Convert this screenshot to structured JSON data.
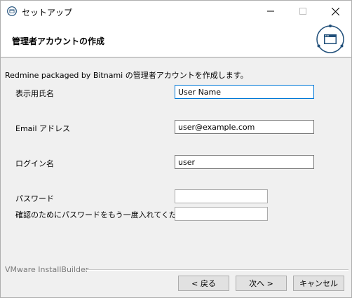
{
  "window": {
    "title": "セットアップ"
  },
  "header": {
    "title": "管理者アカウントの作成"
  },
  "intro": "Redmine packaged by Bitnami の管理者アカウントを作成します。",
  "fields": {
    "display_name": {
      "label": "表示用氏名",
      "value": "User Name"
    },
    "email": {
      "label": "Email アドレス",
      "value": "user@example.com"
    },
    "login": {
      "label": "ログイン名",
      "value": "user"
    },
    "password": {
      "label": "パスワード",
      "value": ""
    },
    "password_confirm": {
      "label": "確認のためにパスワードをもう一度入れてください",
      "value": ""
    }
  },
  "footer": {
    "brand": "VMware InstallBuilder",
    "back_label": "< 戻る",
    "next_label": "次へ >",
    "cancel_label": "キャンセル"
  },
  "icons": {
    "app": "installer-app-icon",
    "logo": "installer-window-logo",
    "minimize": "minimize-icon",
    "maximize": "maximize-icon",
    "close": "close-icon"
  },
  "colors": {
    "focus_border": "#0078d7",
    "logo_ring": "#1f4e79"
  }
}
